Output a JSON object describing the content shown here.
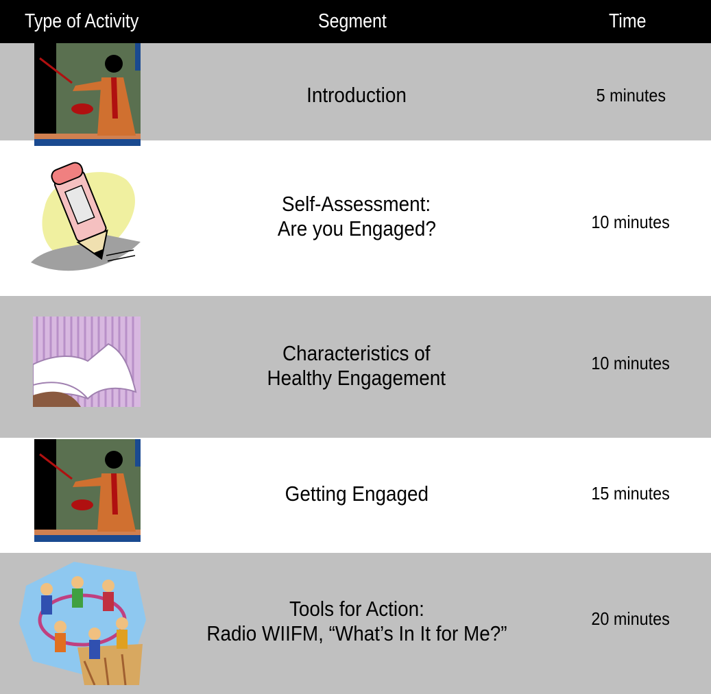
{
  "header": {
    "col_activity": "Type of Activity",
    "col_segment": "Segment",
    "col_time": "Time"
  },
  "colors": {
    "header_bg": "#000000",
    "row_shaded": "#c0c0c0",
    "row_plain": "#ffffff"
  },
  "rows": [
    {
      "icon": "teacher-lecture-icon",
      "segment_line1": "Introduction",
      "segment_line2": "",
      "time": "5 minutes"
    },
    {
      "icon": "pencil-icon",
      "segment_line1": "Self-Assessment:",
      "segment_line2": "Are you Engaged?",
      "time": "10 minutes"
    },
    {
      "icon": "open-book-icon",
      "segment_line1": "Characteristics of",
      "segment_line2": "Healthy Engagement",
      "time": "10 minutes"
    },
    {
      "icon": "teacher-lecture-icon",
      "segment_line1": "Getting Engaged",
      "segment_line2": "",
      "time": "15 minutes"
    },
    {
      "icon": "group-circle-people-icon",
      "segment_line1": "Tools for Action:",
      "segment_line2": "Radio WIIFM, “What’s In It for Me?”",
      "time": "20 minutes"
    }
  ]
}
